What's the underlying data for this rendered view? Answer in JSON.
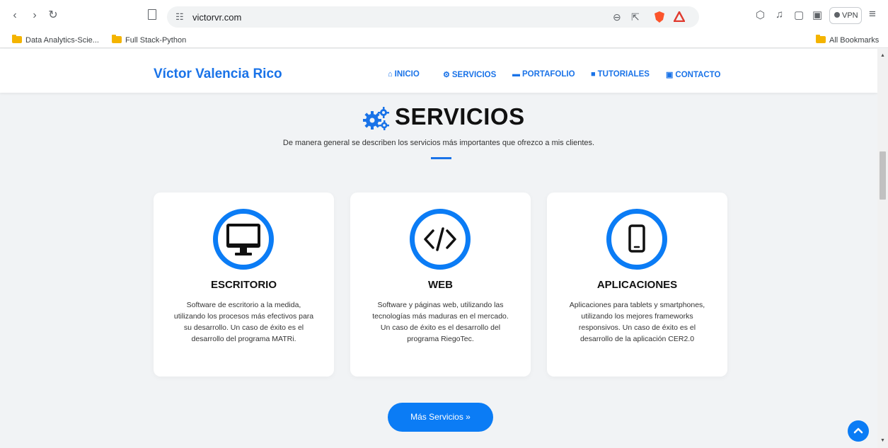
{
  "browser": {
    "url": "victorvr.com",
    "vpn_label": "VPN",
    "bookmarks": [
      {
        "label": "Data Analytics-Scie..."
      },
      {
        "label": "Full Stack-Python"
      }
    ],
    "all_bookmarks_label": "All Bookmarks"
  },
  "site": {
    "brand": "Víctor Valencia Rico",
    "menu": [
      {
        "label": "INICIO",
        "icon": "home-icon"
      },
      {
        "label": "SERVICIOS",
        "icon": "gears-icon"
      },
      {
        "label": "PORTAFOLIO",
        "icon": "briefcase-icon"
      },
      {
        "label": "TUTORIALES",
        "icon": "book-icon"
      },
      {
        "label": "CONTACTO",
        "icon": "contact-icon"
      }
    ]
  },
  "services": {
    "title": "SERVICIOS",
    "subtitle": "De manera general se describen los servicios más importantes que ofrezco a mis clientes.",
    "cards": [
      {
        "title": "ESCRITORIO",
        "icon": "desktop-icon",
        "lines": [
          "Software de escritorio a la medida,",
          "utilizando los procesos más efectivos para",
          "su desarrollo. Un caso de éxito es el",
          "desarrollo del programa MATRi."
        ]
      },
      {
        "title": "WEB",
        "icon": "code-icon",
        "lines": [
          "Software y páginas web, utilizando las",
          "tecnologías más maduras en el mercado.",
          "Un caso de éxito es el desarrollo del",
          "programa RiegoTec."
        ]
      },
      {
        "title": "APLICACIONES",
        "icon": "mobile-icon",
        "lines": [
          "Aplicaciones para tablets y smartphones,",
          "utilizando los mejores frameworks",
          "responsivos. Un caso de éxito es el",
          "desarrollo de la aplicación CER2.0"
        ]
      }
    ],
    "more_button": "Más Servicios »"
  },
  "colors": {
    "accent": "#0b7cf5",
    "brand": "#1a73e8",
    "page_bg": "#f1f3f5"
  }
}
